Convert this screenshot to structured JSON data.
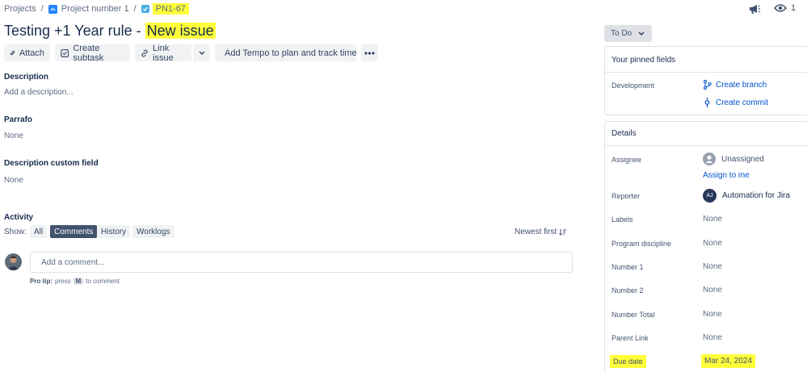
{
  "breadcrumbs": {
    "projects": "Projects",
    "sep": "/",
    "project": "Project number 1",
    "issue_key": "PN1-67"
  },
  "header": {
    "watch_count": "1"
  },
  "issue": {
    "title_main": "Testing +1 Year rule - ",
    "title_highlight": "New issue"
  },
  "toolbar": {
    "attach": "Attach",
    "create_subtask": "Create subtask",
    "link_issue": "Link issue",
    "tempo": "Add Tempo to plan and track time"
  },
  "status": {
    "label": "To Do"
  },
  "fields": {
    "description_label": "Description",
    "description_placeholder": "Add a description...",
    "parrafo_label": "Parrafo",
    "parrafo_value": "None",
    "custom_label": "Description custom field",
    "custom_value": "None"
  },
  "activity": {
    "heading": "Activity",
    "show_label": "Show:",
    "tabs": [
      "All",
      "Comments",
      "History",
      "Worklogs"
    ],
    "active_tab": "Comments",
    "sort": "Newest first",
    "comment_placeholder": "Add a comment...",
    "protip_bold": "Pro tip:",
    "protip_press": "press",
    "protip_key": "M",
    "protip_rest": "to comment"
  },
  "pinned": {
    "title": "Your pinned fields",
    "development_label": "Development",
    "create_branch": "Create branch",
    "create_commit": "Create commit"
  },
  "details": {
    "title": "Details",
    "assignee_label": "Assignee",
    "assignee_value": "Unassigned",
    "assign_to_me": "Assign to me",
    "reporter_label": "Reporter",
    "reporter_initials": "AJ",
    "reporter_value": "Automation for Jira",
    "labels_label": "Labels",
    "labels_value": "None",
    "program_label": "Program discipline",
    "program_value": "None",
    "number1_label": "Number 1",
    "number1_value": "None",
    "number2_label": "Number 2",
    "number2_value": "None",
    "numbertotal_label": "Number Total",
    "numbertotal_value": "None",
    "parent_label": "Parent Link",
    "parent_value": "None",
    "duedate_label": "Due date",
    "duedate_value": "Mar 24, 2024"
  },
  "colors": {
    "highlight": "#ffff3a",
    "link": "#0052cc",
    "active_tab": "#42526e"
  }
}
